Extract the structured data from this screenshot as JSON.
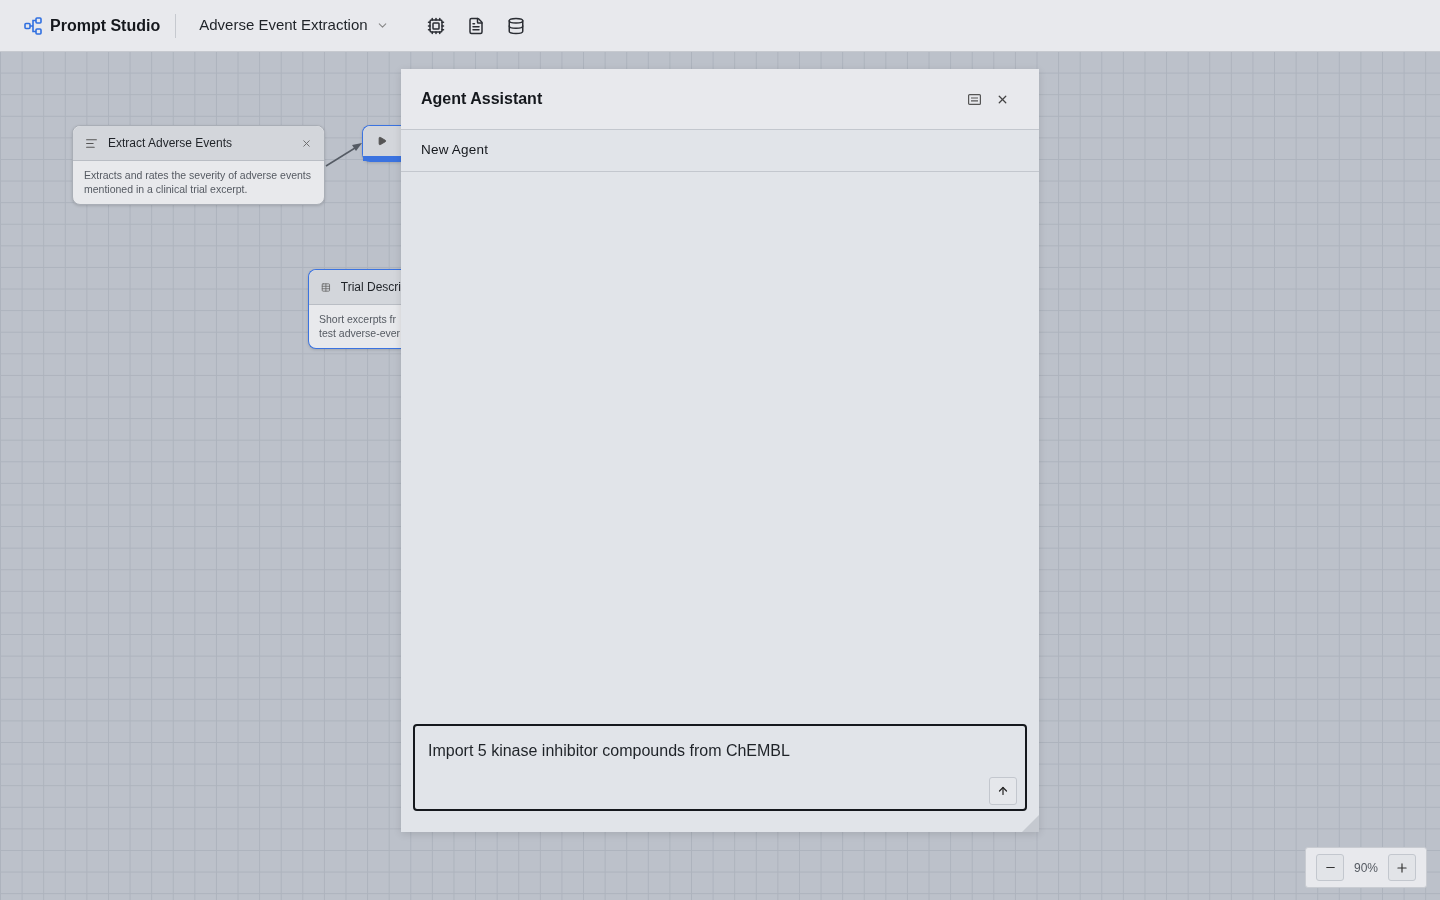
{
  "top_bar": {
    "app_name": "Prompt Studio",
    "project": "Adverse Event Extraction"
  },
  "canvas": {
    "nodes": [
      {
        "kind": "prompt",
        "title": "Extract Adverse Events",
        "description_lines": [
          "Extracts and rates the severity of adverse events",
          "mentioned in a clinical trial excerpt."
        ],
        "selected": false
      },
      {
        "kind": "run",
        "selected": true
      },
      {
        "kind": "dataset",
        "title": "Trial Descri",
        "description_lines": [
          "Short excerpts fr",
          "test adverse-ever"
        ],
        "selected": true
      }
    ],
    "zoom_reading": "90%"
  },
  "agent_panel": {
    "title": "Agent Assistant",
    "agents": [
      {
        "name": "New Agent"
      }
    ],
    "message": "Import 5 kinase inhibitor compounds from ChEMBL"
  }
}
